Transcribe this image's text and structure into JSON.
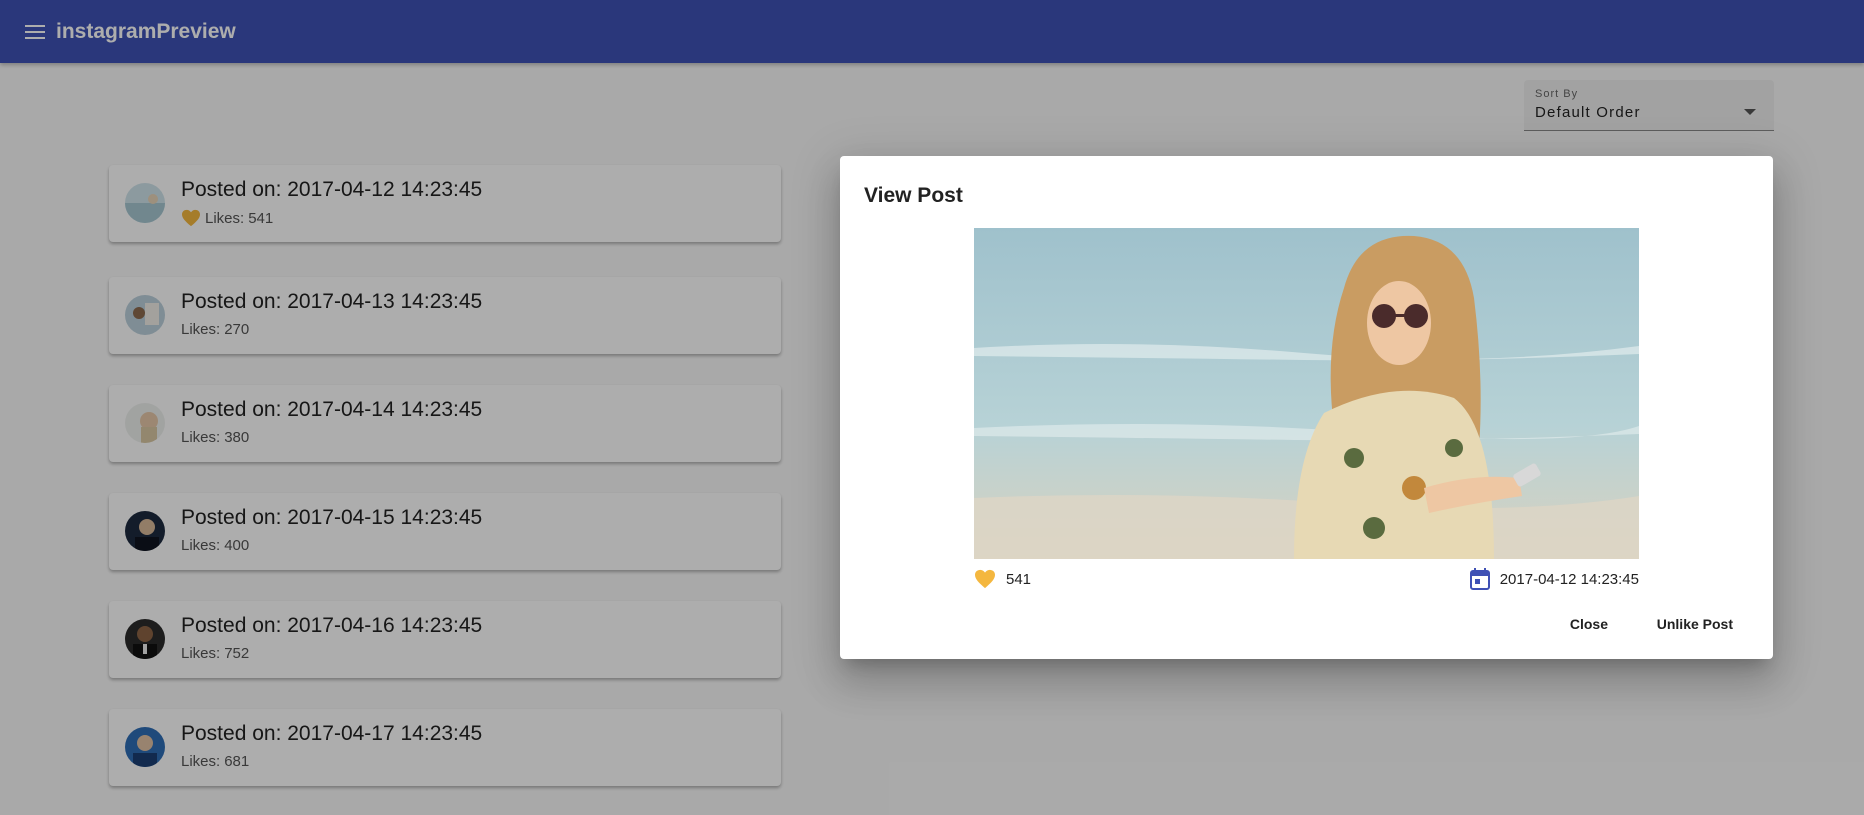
{
  "app": {
    "title": "instagramPreview"
  },
  "sort": {
    "label": "Sort By",
    "value": "Default Order"
  },
  "likes_prefix": "Likes:",
  "posts": [
    {
      "title": "Posted on: 2017-04-12 14:23:45",
      "likes": "541",
      "liked": true
    },
    {
      "title": "Posted on: 2017-04-13 14:23:45",
      "likes": "270",
      "liked": false
    },
    {
      "title": "Posted on: 2017-04-14 14:23:45",
      "likes": "380",
      "liked": false
    },
    {
      "title": "Posted on: 2017-04-15 14:23:45",
      "likes": "400",
      "liked": false
    },
    {
      "title": "Posted on: 2017-04-16 14:23:45",
      "likes": "752",
      "liked": false
    },
    {
      "title": "Posted on: 2017-04-17 14:23:45",
      "likes": "681",
      "liked": false
    }
  ],
  "dialog": {
    "title": "View Post",
    "likes": "541",
    "date": "2017-04-12 14:23:45",
    "close_label": "Close",
    "unlike_label": "Unlike Post"
  },
  "colors": {
    "appbar": "#3f51b5",
    "heart": "#f4b73f",
    "calendar": "#3f51b5"
  },
  "icons": {
    "menu": "menu-icon",
    "sort_caret": "arrow-drop-down-icon",
    "heart": "heart-icon",
    "calendar": "calendar-icon"
  }
}
